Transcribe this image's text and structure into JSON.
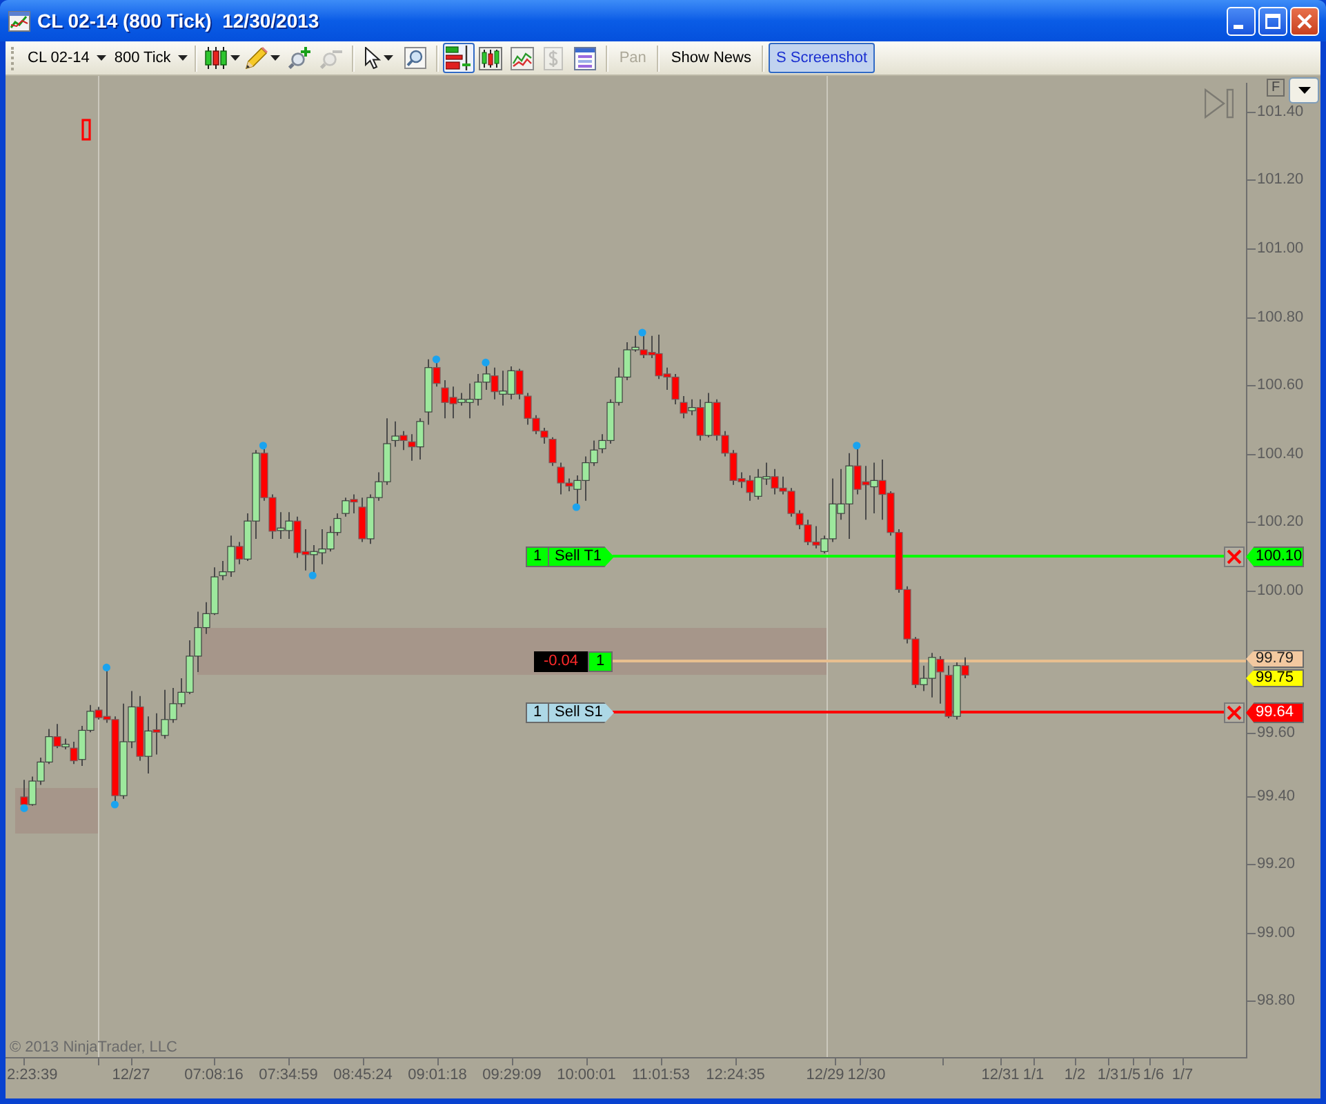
{
  "window": {
    "title": "CL 02-14 (800 Tick)  12/30/2013"
  },
  "toolbar": {
    "groups": [
      {
        "items": [
          {
            "kind": "dropdown",
            "label": "CL 02-14"
          },
          {
            "kind": "dropdown",
            "label": "800 Tick"
          }
        ]
      },
      {
        "items": [
          {
            "kind": "icon-menu",
            "disabled": false,
            "pressed": false
          },
          {
            "kind": "icon-menu",
            "disabled": false,
            "pressed": false
          },
          {
            "kind": "icon",
            "disabled": false,
            "pressed": false
          },
          {
            "kind": "icon",
            "disabled": true,
            "pressed": false
          }
        ]
      },
      {
        "items": [
          {
            "kind": "icon-menu",
            "disabled": false,
            "pressed": false
          },
          {
            "kind": "icon",
            "disabled": false,
            "pressed": false
          }
        ]
      },
      {
        "items": [
          {
            "kind": "icon",
            "disabled": false,
            "pressed": true
          },
          {
            "kind": "icon",
            "disabled": false,
            "pressed": false
          },
          {
            "kind": "icon",
            "disabled": false,
            "pressed": false
          },
          {
            "kind": "icon",
            "disabled": true,
            "pressed": false
          },
          {
            "kind": "icon",
            "disabled": false,
            "pressed": false
          }
        ]
      },
      {
        "items": [
          {
            "kind": "text",
            "label": "Pan",
            "disabled": true,
            "pressed": false
          }
        ]
      },
      {
        "items": [
          {
            "kind": "text",
            "label": "Show News",
            "disabled": false,
            "pressed": false
          }
        ]
      },
      {
        "items": [
          {
            "kind": "text",
            "label": "S Screenshot",
            "disabled": false,
            "pressed": true
          }
        ]
      }
    ]
  },
  "chart": {
    "f_button": "F",
    "price_axis": {
      "labels": [
        "101.40",
        "101.20",
        "101.00",
        "100.80",
        "100.60",
        "100.40",
        "100.20",
        "100.00",
        "99.60",
        "99.40",
        "99.20",
        "99.00",
        "98.80"
      ]
    },
    "orders": [
      {
        "kind": "target",
        "quantity": "1",
        "label": "Sell T1",
        "price": "100.10",
        "color": "#00ff00"
      },
      {
        "kind": "stop",
        "quantity": "1",
        "label": "Sell S1",
        "price": "99.64",
        "color": "#ff0000"
      }
    ],
    "position": {
      "pnl": "-0.04",
      "quantity": "1",
      "price": "99.79"
    },
    "last_price": "99.75",
    "copyright": "© 2013 NinjaTrader, LLC",
    "time_axis": {
      "labels": [
        "2:23:39",
        "12/27",
        "07:08:16",
        "07:34:59",
        "08:45:24",
        "09:01:18",
        "09:29:09",
        "10:00:01",
        "11:01:53",
        "12:24:35",
        "12/29",
        "12/30",
        "12/31",
        "1/1",
        "1/2",
        "1/3",
        "1/5",
        "1/6",
        "1/7"
      ]
    }
  }
}
